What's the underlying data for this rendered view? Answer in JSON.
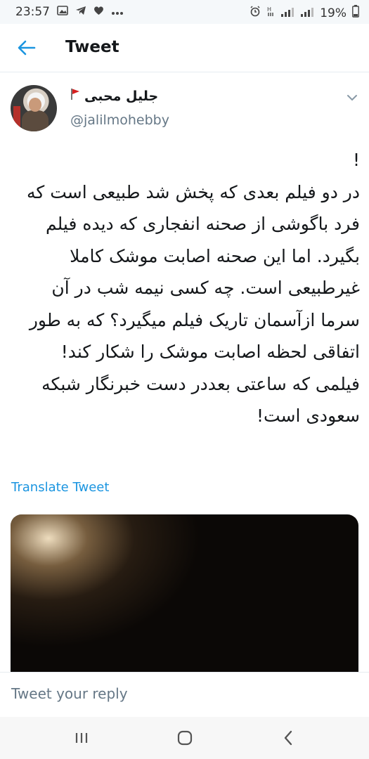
{
  "status_bar": {
    "time": "23:57",
    "left_icons": [
      "gallery-icon",
      "telegram-icon",
      "heart-icon",
      "more-dots-icon"
    ],
    "right_icons": [
      "alarm-icon",
      "vibrate-icon",
      "signal-icon",
      "signal-icon"
    ],
    "battery": "19%"
  },
  "app_bar": {
    "back_icon": "arrow-left-icon",
    "title": "Tweet"
  },
  "tweet": {
    "author_name": "جلیل محبی",
    "author_flag": "red-flag-icon",
    "handle": "@jalilmohebby",
    "paragraphs": [
      "!",
      "در دو فیلم بعدی که پخش شد طبیعی است که فرد باگوشی از صحنه انفجاری که دیده فیلم بگیرد. اما این صحنه اصابت موشک کاملا غیرطبیعی است. چه کسی نیمه شب در آن سرما ازآسمان تاریک فیلم میگیرد؟ که به طور اتفاقی لحظه اصابت موشک را شکار کند!",
      "فیلمی که ساعتی بعددر دست خبرنگار شبکه سعودی است!"
    ],
    "translate_label": "Translate Tweet"
  },
  "reply": {
    "placeholder": "Tweet your reply"
  },
  "nav": {
    "icons": [
      "recent-apps-icon",
      "home-icon",
      "back-icon"
    ]
  },
  "colors": {
    "accent": "#1b95e0",
    "text": "#14171a",
    "secondary": "#657786",
    "divider": "#e6ecf0"
  }
}
